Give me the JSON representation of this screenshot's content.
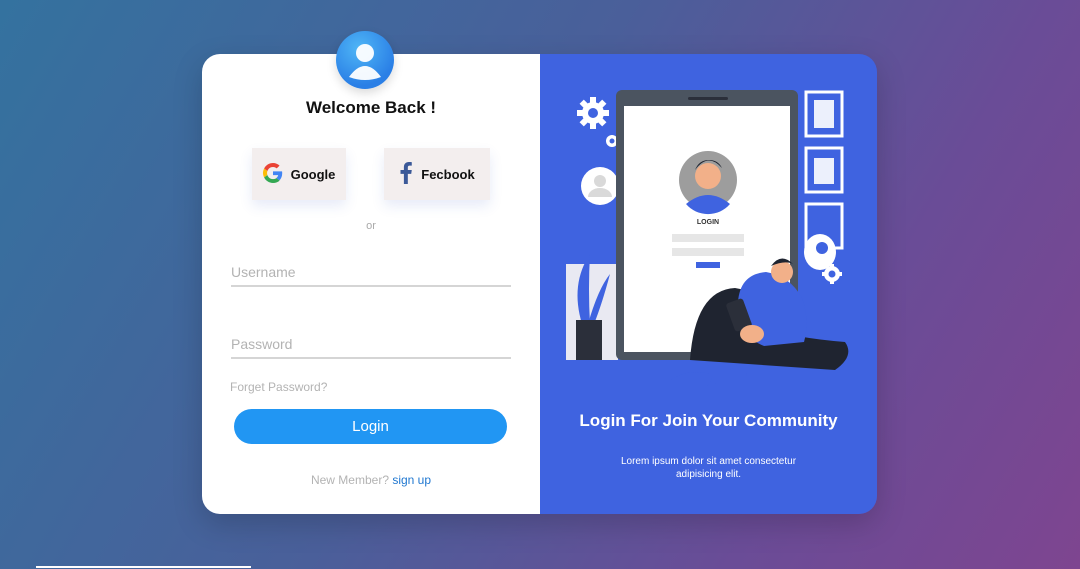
{
  "left": {
    "title": "Welcome Back !",
    "google_label": "Google",
    "facebook_label": "Fecbook",
    "or_text": "or",
    "username_placeholder": "Username",
    "password_placeholder": "Password",
    "forgot_label": "Forget Password?",
    "login_label": "Login",
    "member_text": "New Member? ",
    "signup_label": "sign up"
  },
  "right": {
    "title": "Login For Join Your Community",
    "subtitle": "Lorem ipsum dolor sit amet consectetur adipisicing elit.",
    "screen_login_label": "LOGIN"
  },
  "icons": [
    "user-avatar-icon",
    "google-icon",
    "facebook-icon",
    "gear-icon"
  ],
  "colors": {
    "accent": "#2196f3",
    "panel": "#3f63e0",
    "link": "#1f77d0"
  }
}
